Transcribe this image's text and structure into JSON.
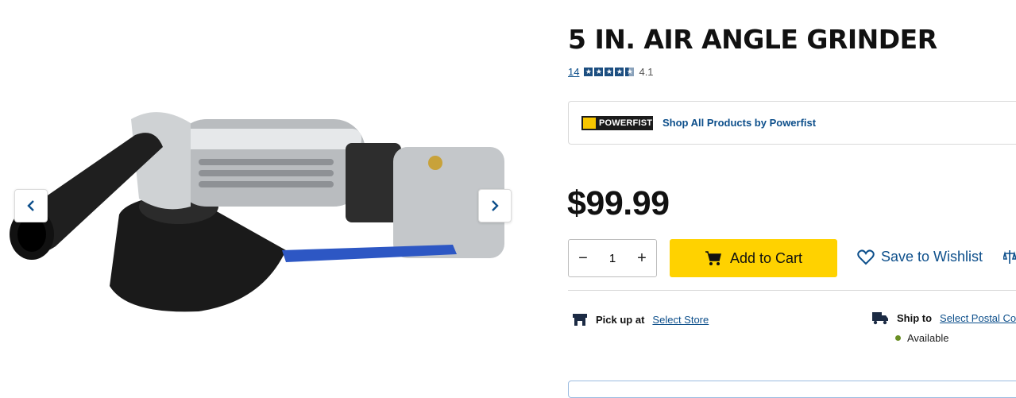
{
  "product": {
    "title": "5 IN. AIR ANGLE GRINDER",
    "review_count": "14",
    "rating": "4.1",
    "rating_fraction": 0.82,
    "price": "$99.99"
  },
  "brand": {
    "logo_text": "POWERFIST",
    "link_label": "Shop All Products by Powerfist"
  },
  "purchase": {
    "quantity": "1",
    "decrease_symbol": "−",
    "increase_symbol": "+",
    "add_to_cart": "Add to Cart",
    "save_to_wishlist": "Save to Wishlist"
  },
  "fulfillment": {
    "pickup_label": "Pick up at",
    "pickup_link": "Select Store",
    "ship_label": "Ship to",
    "ship_link": "Select Postal Co",
    "availability": "Available"
  },
  "colors": {
    "accent_yellow": "#ffd200",
    "link_blue": "#0d4f8b",
    "star_blue": "#1c4e80",
    "available_green": "#6a8f24"
  },
  "icons": [
    "chevron-left-icon",
    "chevron-right-icon",
    "star-icon",
    "cart-icon",
    "heart-icon",
    "scale-icon",
    "store-icon",
    "truck-icon"
  ]
}
